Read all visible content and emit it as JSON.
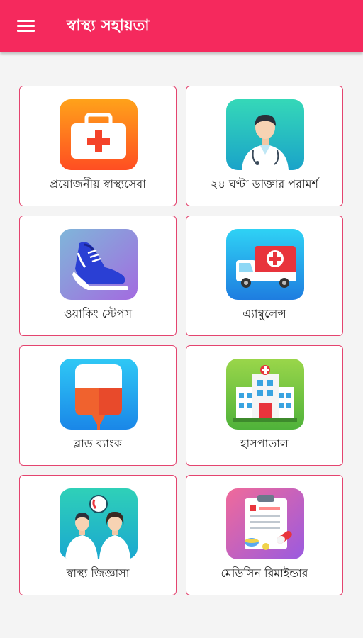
{
  "app_bar": {
    "title": "স্বাস্থ্য সহায়তা",
    "menu_icon": "hamburger-menu-icon",
    "color": "#f5295d"
  },
  "tiles": [
    {
      "label": "প্রয়োজনীয় স্বাস্থ্যসেবা",
      "icon": "first-aid-kit-icon"
    },
    {
      "label": "২৪ ঘণ্টা ডাক্তার পরামর্শ",
      "icon": "doctor-icon"
    },
    {
      "label": "ওয়াকিং স্টেপস",
      "icon": "sneaker-icon"
    },
    {
      "label": "এ্যাম্বুলেন্স",
      "icon": "ambulance-icon"
    },
    {
      "label": "ব্লাড ব্যাংক",
      "icon": "blood-bag-icon"
    },
    {
      "label": "হাসপাতাল",
      "icon": "hospital-icon"
    },
    {
      "label": "স্বাস্থ্য জিজ্ঞাসা",
      "icon": "health-inquiry-icon"
    },
    {
      "label": "মেডিসিন রিমাইন্ডার",
      "icon": "medicine-reminder-icon"
    }
  ],
  "card_border_color": "#e4446f"
}
